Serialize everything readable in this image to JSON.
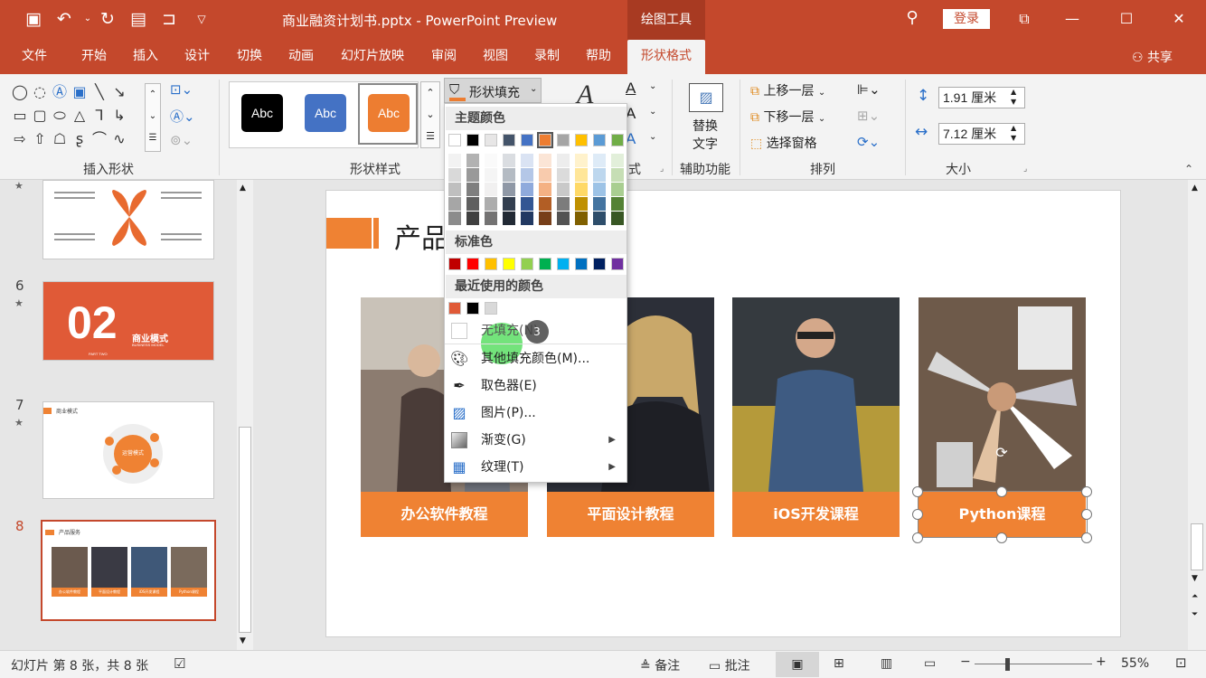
{
  "window": {
    "title": "商业融资计划书.pptx - PowerPoint Preview",
    "context_tab": "绘图工具",
    "login": "登录",
    "share": "共享"
  },
  "tabs": [
    "文件",
    "开始",
    "插入",
    "设计",
    "切换",
    "动画",
    "幻灯片放映",
    "审阅",
    "视图",
    "录制",
    "帮助",
    "形状格式"
  ],
  "active_tab": "形状格式",
  "ribbon": {
    "group_insert_shapes": "插入形状",
    "group_shape_styles": "形状样式",
    "style_samples": [
      "Abc",
      "Abc",
      "Abc"
    ],
    "shape_fill": "形状填充",
    "wordart_label_tail": "式",
    "alt_text": [
      "替换",
      "文字"
    ],
    "group_accessibility": "辅助功能",
    "bring_forward": "上移一层",
    "send_backward": "下移一层",
    "selection_pane": "选择窗格",
    "group_arrange": "排列",
    "height": "1.91 厘米",
    "width": "7.12 厘米",
    "group_size": "大小"
  },
  "fill_menu": {
    "theme_colors": "主题颜色",
    "standard_colors": "标准色",
    "recent_colors": "最近使用的颜色",
    "no_fill": "无填充(N)",
    "more_colors": "其他填充颜色(M)...",
    "eyedropper": "取色器(E)",
    "picture": "图片(P)...",
    "gradient": "渐变(G)",
    "texture": "纹理(T)",
    "cursor_badge": "3",
    "theme_top_row": [
      "#ffffff",
      "#000000",
      "#e7e6e6",
      "#44546a",
      "#4472c4",
      "#ed7d31",
      "#a5a5a5",
      "#ffc000",
      "#5b9bd5",
      "#70ad47"
    ],
    "standard_row": [
      "#c00000",
      "#ff0000",
      "#ffc000",
      "#ffff00",
      "#92d050",
      "#00b050",
      "#00b0f0",
      "#0070c0",
      "#002060",
      "#7030a0"
    ],
    "recent_row": [
      "#e05a37",
      "#000000",
      "#d9d9d9"
    ]
  },
  "thumbnails": [
    {
      "num": "",
      "label": ""
    },
    {
      "num": "6",
      "big": "02",
      "title": "商业模式",
      "sub": "BUSINESS MODEL",
      "part": "PART TWO"
    },
    {
      "num": "7",
      "title": "商业模式",
      "center": "运营模式"
    },
    {
      "num": "8",
      "title": "产品服务",
      "cards": [
        "办公软件教程",
        "平面设计教程",
        "iOS开发课程",
        "Python课程"
      ]
    }
  ],
  "slide": {
    "title": "产品",
    "cards": [
      "办公软件教程",
      "平面设计教程",
      "iOS开发课程",
      "Python课程"
    ]
  },
  "status": {
    "slide_info": "幻灯片 第 8 张，共 8 张",
    "notes": "备注",
    "comments": "批注",
    "zoom": "55%"
  }
}
